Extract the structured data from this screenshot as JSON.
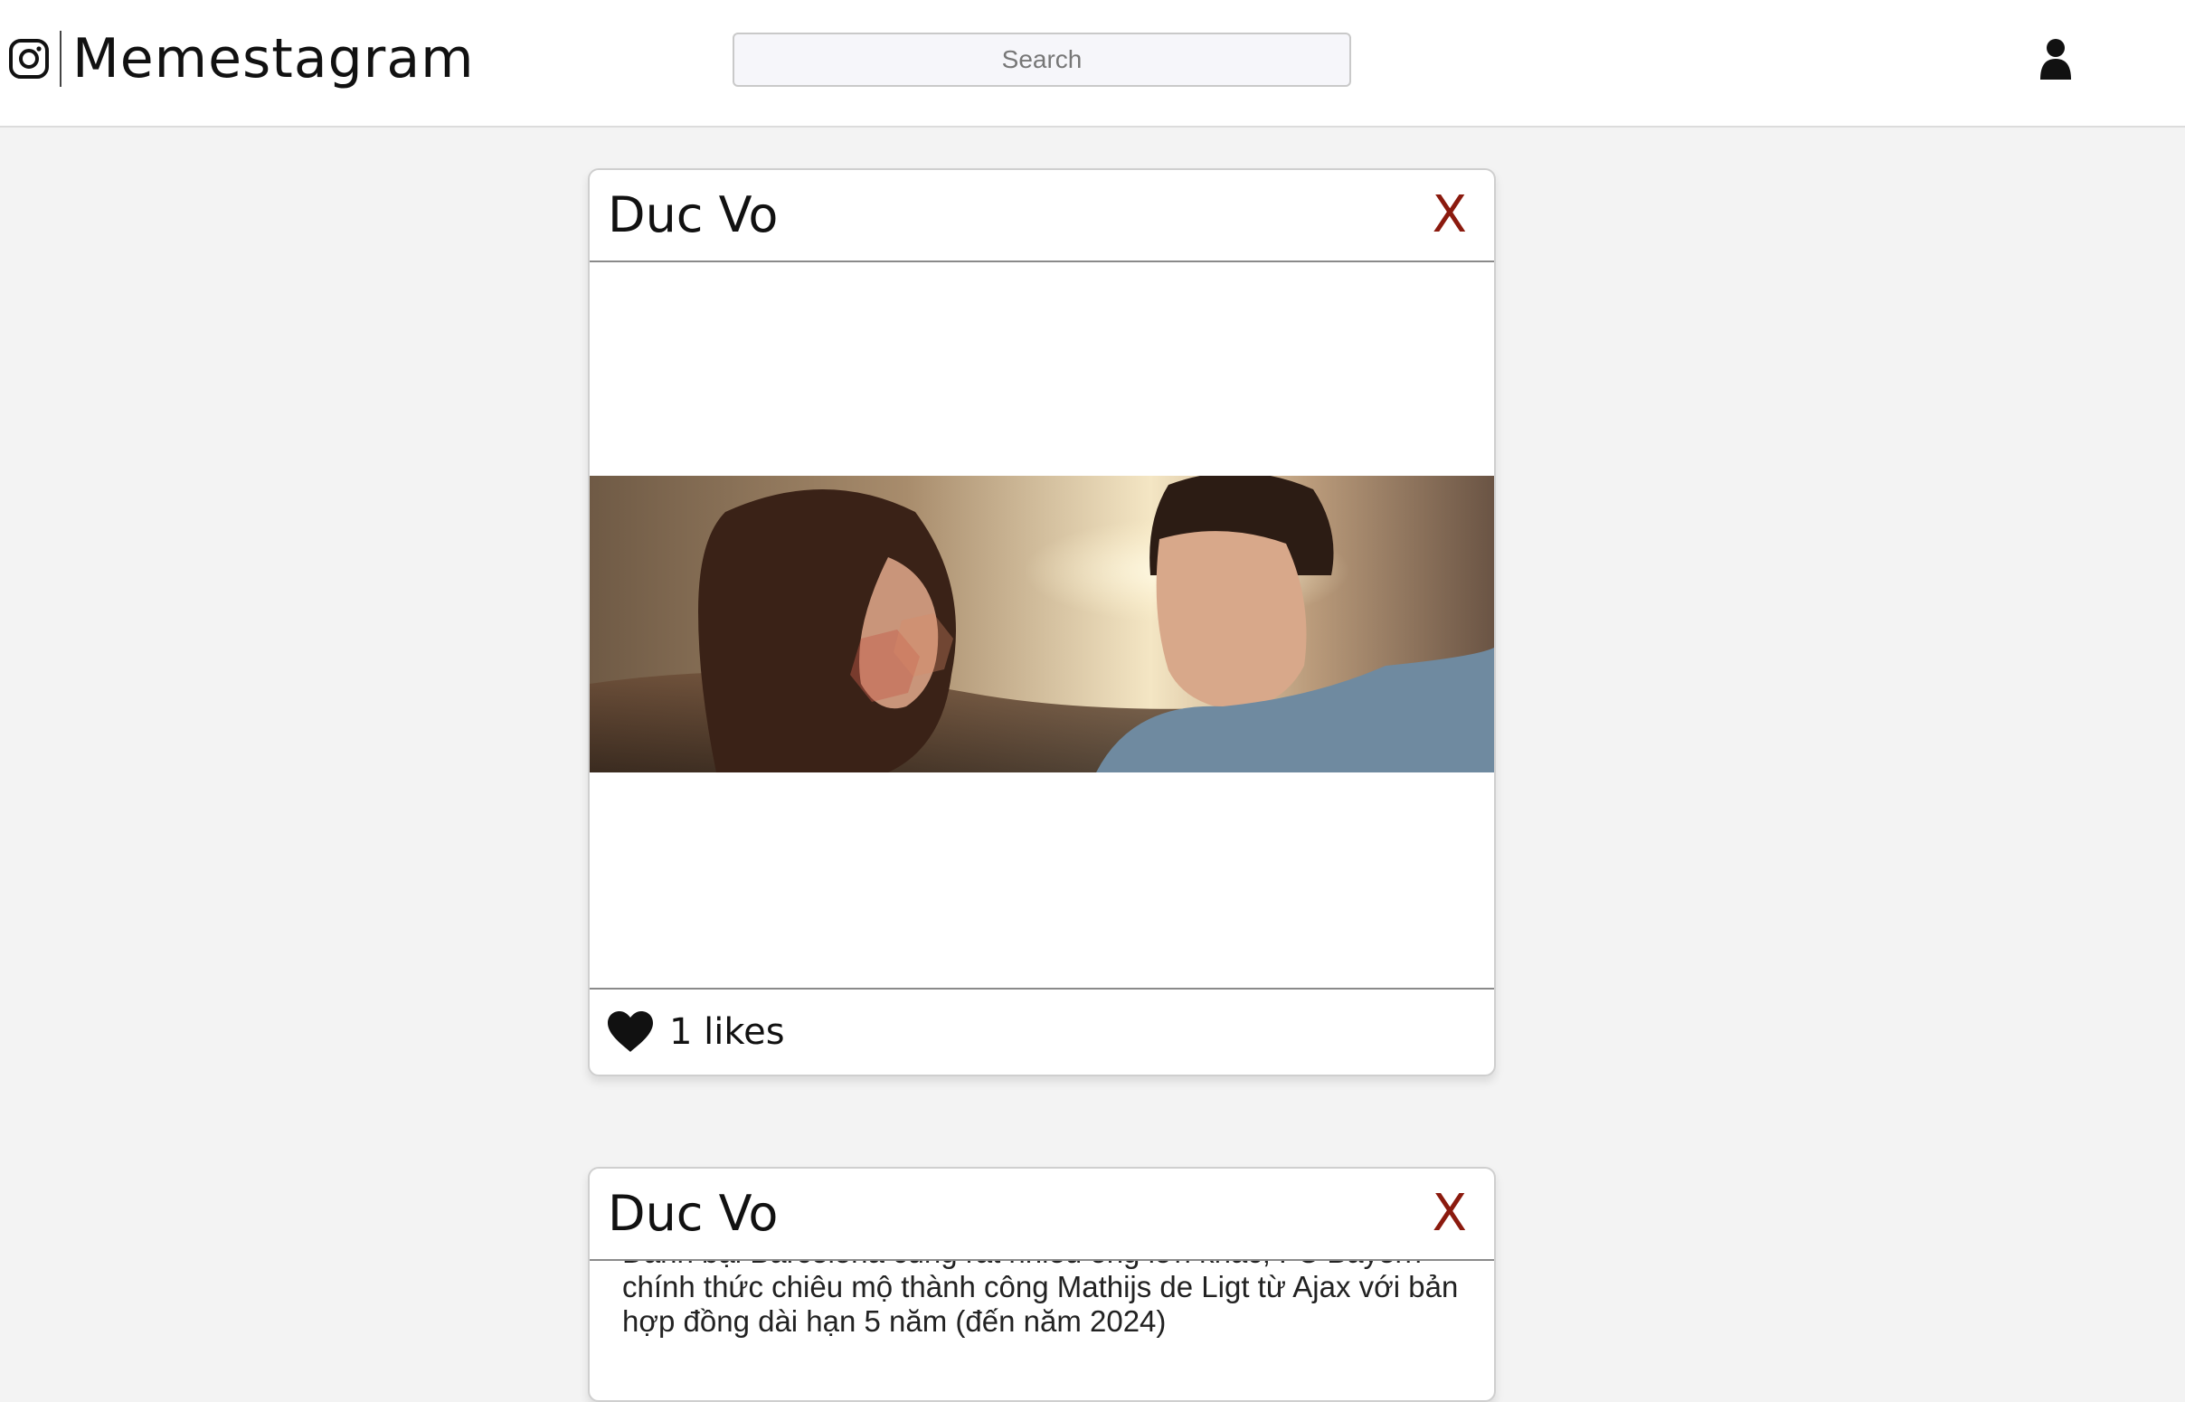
{
  "app": {
    "name": "Memestagram"
  },
  "header": {
    "search_placeholder": "Search",
    "logo_icon": "instagram-icon",
    "account_icon": "user-icon"
  },
  "posts": [
    {
      "author": "Duc Vo",
      "delete_label": "X",
      "media_kind": "photo",
      "likes_label": "1 likes"
    },
    {
      "author": "Duc Vo",
      "delete_label": "X",
      "media_kind": "text-image",
      "text": "Đánh bại Barcelona cùng rất nhiều ông lớn khác, FC Bayern chính thức chiêu mộ thành công Mathijs de Ligt từ Ajax với bản hợp đồng dài hạn 5 năm (đến năm 2024)"
    }
  ],
  "colors": {
    "delete": "#8b1a0e",
    "background": "#f3f3f3"
  }
}
